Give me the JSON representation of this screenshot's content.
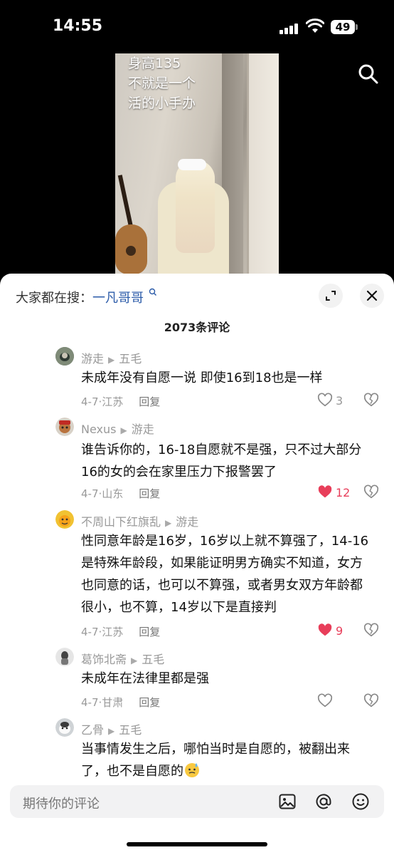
{
  "status": {
    "time": "14:55",
    "battery": "49"
  },
  "video": {
    "caption_lines": [
      "身高135",
      "不就是一个",
      "活的小手办"
    ]
  },
  "sheet": {
    "search_prefix": "大家都在搜：",
    "search_query": "一凡哥哥",
    "comment_count": "2073条评论"
  },
  "comments": [
    {
      "user": "游走",
      "reply_to": "五毛",
      "text": [
        "未成年没有自愿一说 即使16到18也是一样"
      ],
      "date_loc": "4-7·江苏",
      "reply": "回复",
      "likes": "3",
      "liked": false
    },
    {
      "user": "Nexus",
      "reply_to": "游走",
      "text": [
        "谁告诉你的，16-18自愿就不是强，只不过大部分",
        "16的女的会在家里压力下报警罢了"
      ],
      "date_loc": "4-7·山东",
      "reply": "回复",
      "likes": "12",
      "liked": true
    },
    {
      "user": "不周山下红旗乱",
      "reply_to": "游走",
      "text": [
        "性同意年龄是16岁，16岁以上就不算强了，14-16",
        "是特殊年龄段，如果能证明男方确实不知道，女方",
        "也同意的话，也可以不算强，或者男女双方年龄都",
        "很小，也不算，14岁以下是直接判"
      ],
      "date_loc": "4-7·江苏",
      "reply": "回复",
      "likes": "9",
      "liked": true
    },
    {
      "user": "葛饰北斋",
      "reply_to": "五毛",
      "text": [
        "未成年在法律里都是强"
      ],
      "date_loc": "4-7·甘肃",
      "reply": "回复",
      "likes": "",
      "liked": false
    },
    {
      "user": "乙骨",
      "reply_to": "五毛",
      "text": [
        "当事情发生之后，哪怕当时是自愿的，被翻出来",
        "了，也不是自愿的"
      ],
      "date_loc": "",
      "reply": "",
      "likes": "",
      "liked": false
    }
  ],
  "input": {
    "placeholder": "期待你的评论"
  },
  "colors": {
    "like_red": "#e83e5a",
    "link_blue": "#2a5aa8"
  }
}
